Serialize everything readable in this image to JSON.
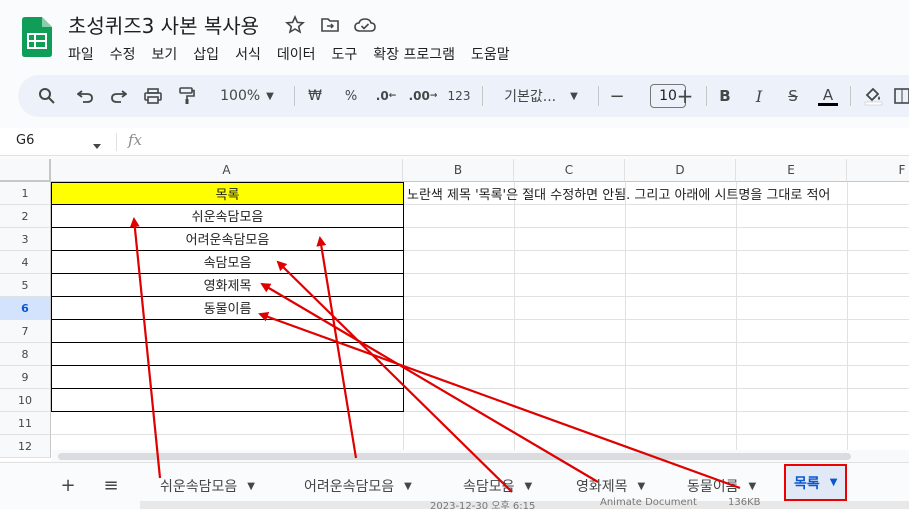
{
  "app": {
    "title": "초성퀴즈3 사본 복사용",
    "menu": [
      "파일",
      "수정",
      "보기",
      "삽입",
      "서식",
      "데이터",
      "도구",
      "확장 프로그램",
      "도움말"
    ]
  },
  "toolbar": {
    "zoom": "100%",
    "currency": "₩",
    "percent": "%",
    "dec_decrease": ".0",
    "dec_increase": ".00",
    "number_format": "123",
    "font": "기본값...",
    "font_size": "10",
    "minus": "−",
    "plus": "+",
    "bold": "B",
    "italic": "I",
    "strike": "S",
    "text_color": "A"
  },
  "formula_bar": {
    "name_box": "G6",
    "fx": "fx"
  },
  "grid": {
    "columns": [
      "A",
      "B",
      "C",
      "D",
      "E",
      "F"
    ],
    "rows": [
      "1",
      "2",
      "3",
      "4",
      "5",
      "6",
      "7",
      "8",
      "9",
      "10",
      "11",
      "12"
    ],
    "selected_row": "6",
    "a1": "목록",
    "b1": "노란색 제목 '목록'은 절대 수정하면 안됨. 그리고 아래에 시트명을 그대로 적어",
    "a_values": [
      "쉬운속담모음",
      "어려운속담모음",
      "속담모음",
      "영화제목",
      "동물이름"
    ]
  },
  "sheets": {
    "add": "+",
    "list": "≡",
    "tabs": [
      "쉬운속담모음",
      "어려운속담모음",
      "속담모음",
      "영화제목",
      "동물이름"
    ],
    "active": "목록"
  },
  "background_strip": {
    "text1": "2023-12-30 오후 6:15",
    "text2": "Animate Document",
    "text3": "136KB"
  },
  "colors": {
    "highlight_yellow": "#ffff00",
    "annotation_red": "#e00000",
    "accent_blue": "#0b57d0",
    "sheets_green": "#0f9d58"
  }
}
